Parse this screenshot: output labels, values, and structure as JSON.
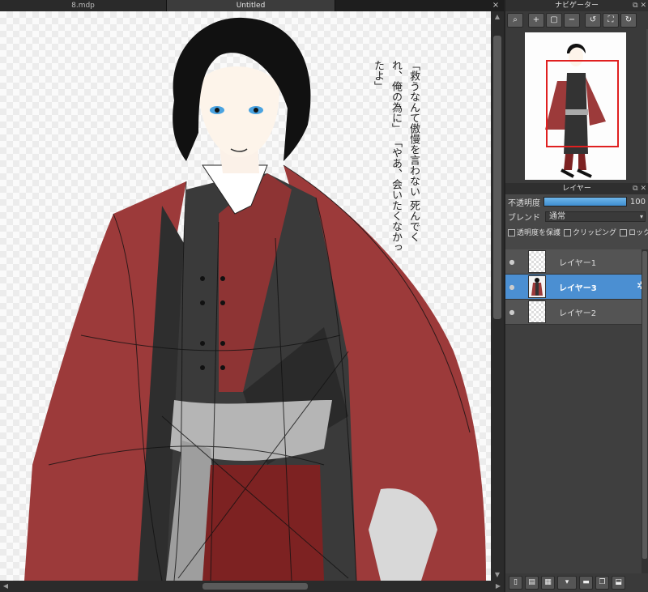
{
  "tabs": [
    {
      "label": "8.mdp"
    },
    {
      "label": "Untitled"
    }
  ],
  "tab_close": "×",
  "canvas": {
    "handwritten_note": [
      "「救うなんて傲慢を言わない",
      "死んでくれ、俺の為に」",
      "「やあ、会いたくなかったよ」"
    ]
  },
  "navigator": {
    "title": "ナビゲーター",
    "tools": [
      {
        "icon": "zoom-fit-icon",
        "glyph": "⌕"
      },
      {
        "icon": "zoom-in-icon",
        "glyph": "+"
      },
      {
        "icon": "actual-size-icon",
        "glyph": "▢"
      },
      {
        "icon": "zoom-out-icon",
        "glyph": "−"
      },
      {
        "icon": "rotate-left-icon",
        "glyph": "↺"
      },
      {
        "icon": "fit-window-icon",
        "glyph": "⛶"
      },
      {
        "icon": "rotate-right-icon",
        "glyph": "↻"
      }
    ],
    "viewport_color": "#e02020"
  },
  "layers_panel": {
    "title": "レイヤー",
    "opacity_label": "不透明度",
    "opacity_value": "100",
    "opacity_percent": 100,
    "blend_label": "ブレンド",
    "blend_value": "通常",
    "preserve_opacity_label": "透明度を保護",
    "clipping_label": "クリッピング",
    "lock_label": "ロック",
    "layers": [
      {
        "name": "レイヤー1",
        "selected": false
      },
      {
        "name": "レイヤー3",
        "selected": true
      },
      {
        "name": "レイヤー2",
        "selected": false
      }
    ],
    "accent_color": "#4b8fd2"
  },
  "bottom_tools": [
    {
      "icon": "new-layer-icon",
      "glyph": "▯"
    },
    {
      "icon": "new-halftone-layer-icon",
      "glyph": "▤"
    },
    {
      "icon": "new-1bit-layer-icon",
      "glyph": "▦"
    },
    {
      "icon": "add-layer-menu-icon",
      "glyph": "▾"
    },
    {
      "icon": "folder-icon",
      "glyph": "▬"
    },
    {
      "icon": "duplicate-layer-icon",
      "glyph": "❐"
    },
    {
      "icon": "merge-layer-icon",
      "glyph": "⬓"
    }
  ]
}
